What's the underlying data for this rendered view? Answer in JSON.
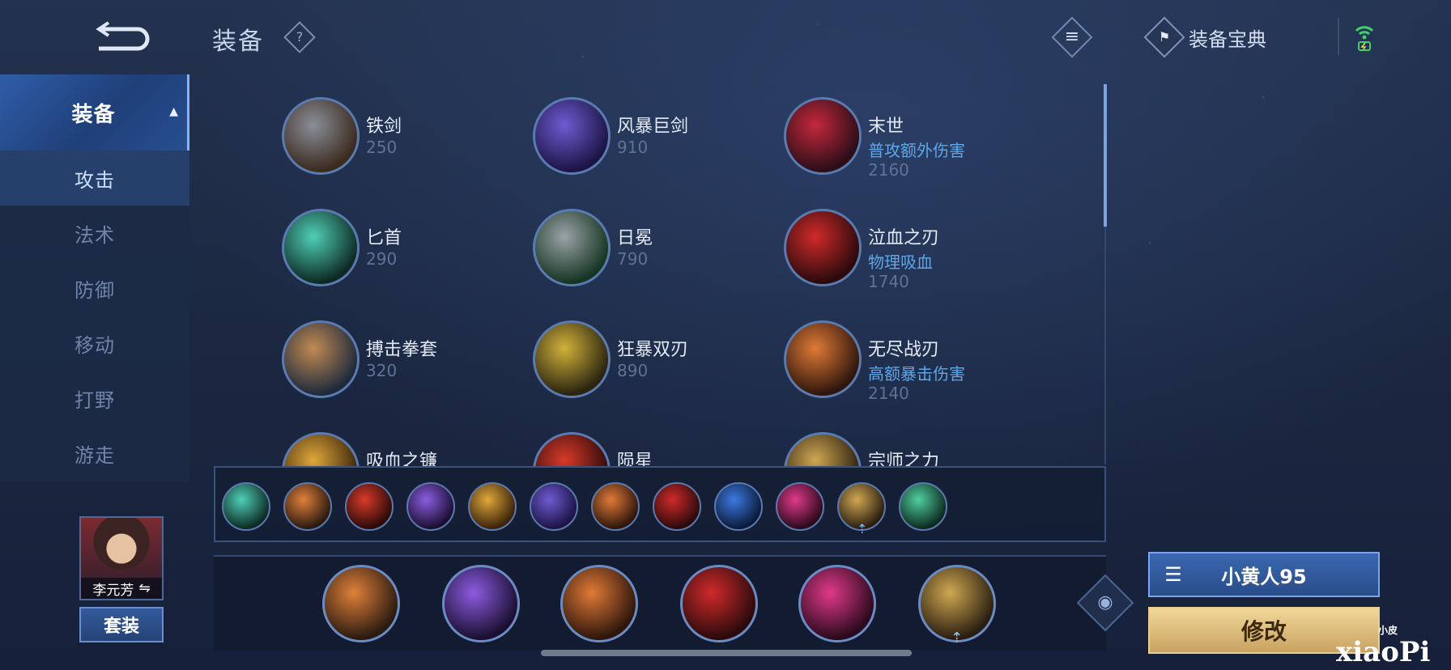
{
  "header": {
    "title": "装备",
    "help": "?",
    "codex_label": "装备宝典"
  },
  "sidebar": {
    "items": [
      {
        "label": "装备"
      },
      {
        "label": "攻击"
      },
      {
        "label": "法术"
      },
      {
        "label": "防御"
      },
      {
        "label": "移动"
      },
      {
        "label": "打野"
      },
      {
        "label": "游走"
      }
    ],
    "hero_name": "李元芳",
    "set_label": "套装"
  },
  "items": [
    {
      "name": "铁剑",
      "price": "250",
      "colors": [
        "#8a8f99",
        "#3b2a1e"
      ]
    },
    {
      "name": "风暴巨剑",
      "price": "910",
      "colors": [
        "#6f5bd1",
        "#1c1445"
      ]
    },
    {
      "name": "末世",
      "effect": "普攻额外伤害",
      "price": "2160",
      "colors": [
        "#c3283c",
        "#2a0e18"
      ]
    },
    {
      "name": "匕首",
      "price": "290",
      "colors": [
        "#4fd0b6",
        "#0d2a24"
      ]
    },
    {
      "name": "日冕",
      "price": "790",
      "colors": [
        "#9aa3a6",
        "#163523"
      ]
    },
    {
      "name": "泣血之刃",
      "effect": "物理吸血",
      "price": "1740",
      "colors": [
        "#d02a2a",
        "#2a0a0c"
      ]
    },
    {
      "name": "搏击拳套",
      "price": "320",
      "colors": [
        "#c18a52",
        "#1e2a3c"
      ]
    },
    {
      "name": "狂暴双刃",
      "price": "890",
      "colors": [
        "#d2b23a",
        "#2a2410"
      ]
    },
    {
      "name": "无尽战刃",
      "effect": "高额暴击伤害",
      "price": "2140",
      "colors": [
        "#e07a36",
        "#2e160c"
      ]
    },
    {
      "name": "吸血之镰",
      "colors": [
        "#e0a83a",
        "#3a230a"
      ]
    },
    {
      "name": "陨星",
      "colors": [
        "#d83a2a",
        "#2a0a08"
      ]
    },
    {
      "name": "宗师之力",
      "colors": [
        "#d0a852",
        "#2a1e10"
      ]
    }
  ],
  "recent": [
    {
      "icon": "dagger-icon",
      "colors": [
        "#4fd0b6",
        "#0d2a24"
      ]
    },
    {
      "icon": "boots-icon",
      "colors": [
        "#e0803a",
        "#2a1a10"
      ]
    },
    {
      "icon": "meteor-icon",
      "colors": [
        "#d83a2a",
        "#2a0a08"
      ]
    },
    {
      "icon": "axe-icon",
      "colors": [
        "#8c5ce0",
        "#1a0f30"
      ]
    },
    {
      "icon": "scythe-icon",
      "colors": [
        "#e0a83a",
        "#3a230a"
      ]
    },
    {
      "icon": "storm-sword-icon",
      "colors": [
        "#6f5bd1",
        "#1c1445"
      ]
    },
    {
      "icon": "infinity-blade-icon",
      "colors": [
        "#e07a36",
        "#2e160c"
      ]
    },
    {
      "icon": "bloodweeper-icon",
      "colors": [
        "#d02a2a",
        "#2a0a0c"
      ]
    },
    {
      "icon": "blue-blade-icon",
      "colors": [
        "#3a7ae0",
        "#0c1a3a"
      ]
    },
    {
      "icon": "pink-blade-icon",
      "colors": [
        "#e03a8a",
        "#2a0a1c"
      ]
    },
    {
      "icon": "master-power-icon",
      "colors": [
        "#d0a852",
        "#2a1e10"
      ],
      "arrow": true
    },
    {
      "icon": "green-boots-icon",
      "colors": [
        "#4fd0a0",
        "#0d2a20"
      ]
    }
  ],
  "build": [
    {
      "icon": "armored-boots-icon",
      "colors": [
        "#e0803a",
        "#2a1a10"
      ]
    },
    {
      "icon": "purple-axe-icon",
      "colors": [
        "#8c5ce0",
        "#1a0f30"
      ]
    },
    {
      "icon": "infinity-blade-icon",
      "colors": [
        "#e07a36",
        "#2e160c"
      ]
    },
    {
      "icon": "bloodweeper-icon",
      "colors": [
        "#d02a2a",
        "#2a0a0c"
      ]
    },
    {
      "icon": "pink-blade-icon",
      "colors": [
        "#e03a8a",
        "#2a0a1c"
      ]
    },
    {
      "icon": "master-power-icon",
      "colors": [
        "#d0a852",
        "#2a1e10"
      ],
      "arrow": true
    }
  ],
  "right_panel": {
    "build_name": "小黄人95",
    "edit_label": "修改"
  },
  "watermark": {
    "small": "小皮",
    "main": "xiaoPi"
  }
}
